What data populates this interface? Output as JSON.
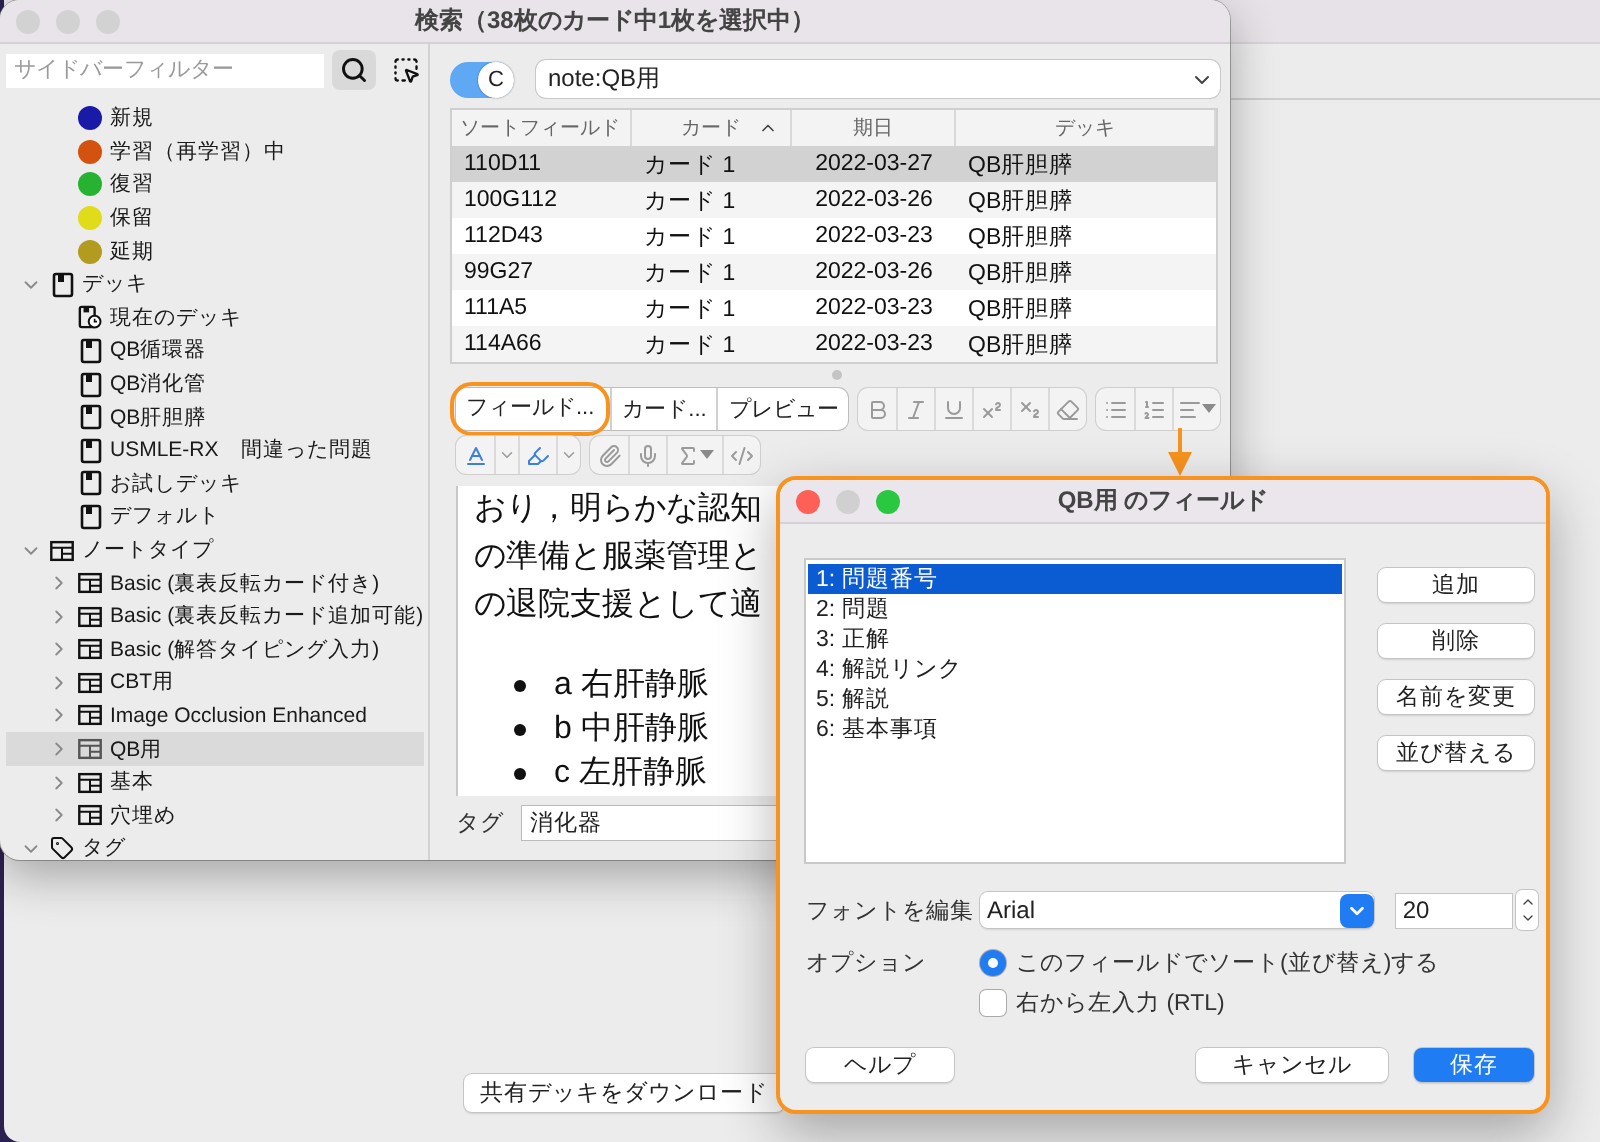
{
  "browser_window": {
    "title": "検索（38枚のカード中1枚を選択中）",
    "sidebar": {
      "filter": {
        "placeholder": "サイドバーフィルター"
      },
      "card_states": [
        {
          "label": "新規",
          "color": "#1a1aa8"
        },
        {
          "label": "学習（再学習）中",
          "color": "#d4520f"
        },
        {
          "label": "復習",
          "color": "#28b232"
        },
        {
          "label": "保留",
          "color": "#e0dc1a"
        },
        {
          "label": "延期",
          "color": "#b39b1f"
        }
      ],
      "sections": [
        {
          "label": "デッキ",
          "kind": "deck",
          "expanded": true,
          "children": [
            {
              "label": "現在のデッキ",
              "kind": "current_deck",
              "selected": false
            },
            {
              "label": "QB循環器",
              "kind": "deck",
              "selected": false
            },
            {
              "label": "QB消化管",
              "kind": "deck",
              "selected": false
            },
            {
              "label": "QB肝胆膵",
              "kind": "deck",
              "selected": false
            },
            {
              "label": "USMLE-RX　間違った問題",
              "kind": "deck",
              "selected": false
            },
            {
              "label": "お試しデッキ",
              "kind": "deck",
              "selected": false
            },
            {
              "label": "デフォルト",
              "kind": "deck",
              "selected": false
            }
          ]
        },
        {
          "label": "ノートタイプ",
          "kind": "note_type",
          "expanded": true,
          "children": [
            {
              "label": "Basic (裏表反転カード付き)",
              "kind": "note_type",
              "expanded": false,
              "selected": false
            },
            {
              "label": "Basic (裏表反転カード追加可能)",
              "kind": "note_type",
              "expanded": false,
              "selected": false
            },
            {
              "label": "Basic (解答タイピング入力)",
              "kind": "note_type",
              "expanded": false,
              "selected": false
            },
            {
              "label": "CBT用",
              "kind": "note_type",
              "expanded": false,
              "selected": false
            },
            {
              "label": "Image Occlusion Enhanced",
              "kind": "note_type",
              "expanded": false,
              "selected": false
            },
            {
              "label": "QB用",
              "kind": "note_type",
              "expanded": false,
              "selected": true
            },
            {
              "label": "基本",
              "kind": "note_type",
              "expanded": false,
              "selected": false
            },
            {
              "label": "穴埋め",
              "kind": "note_type",
              "expanded": false,
              "selected": false
            }
          ]
        },
        {
          "label": "タグ",
          "kind": "tag",
          "expanded": true
        }
      ]
    },
    "search": {
      "mode": {
        "label": "C",
        "on": true
      },
      "query": "note:QB用"
    },
    "table": {
      "columns": [
        {
          "label": "ソートフィールド"
        },
        {
          "label": "カード",
          "sorted": true
        },
        {
          "label": "期日"
        },
        {
          "label": "デッキ"
        }
      ],
      "rows": [
        {
          "cells": [
            "110D11",
            "カード 1",
            "2022-03-27",
            "QB肝胆膵"
          ],
          "selected": true
        },
        {
          "cells": [
            "100G112",
            "カード 1",
            "2022-03-26",
            "QB肝胆膵"
          ],
          "selected": false
        },
        {
          "cells": [
            "112D43",
            "カード 1",
            "2022-03-23",
            "QB肝胆膵"
          ],
          "selected": false
        },
        {
          "cells": [
            "99G27",
            "カード 1",
            "2022-03-26",
            "QB肝胆膵"
          ],
          "selected": false
        },
        {
          "cells": [
            "111A5",
            "カード 1",
            "2022-03-23",
            "QB肝胆膵"
          ],
          "selected": false
        },
        {
          "cells": [
            "114A66",
            "カード 1",
            "2022-03-23",
            "QB肝胆膵"
          ],
          "selected": false
        }
      ]
    },
    "editor": {
      "buttons": [
        "フィールド...",
        "カード...",
        "プレビュー"
      ],
      "content": {
        "lines": [
          "おり，明らかな認知",
          "の準備と服薬管理と",
          "の退院支援として適"
        ],
        "bullets": [
          "a 右肝静脈",
          "b 中肝静脈",
          "c 左肝静脈"
        ]
      },
      "tags": {
        "label": "タグ",
        "value": "消化器"
      }
    }
  },
  "main_window": {
    "buttons": [
      "共有デッキをダウンロード"
    ]
  },
  "fields_dialog": {
    "title": "QB用 のフィールド",
    "fields": [
      {
        "label": "1: 問題番号",
        "selected": true
      },
      {
        "label": "2: 問題",
        "selected": false
      },
      {
        "label": "3: 正解",
        "selected": false
      },
      {
        "label": "4: 解説リンク",
        "selected": false
      },
      {
        "label": "5: 解説",
        "selected": false
      },
      {
        "label": "6: 基本事項",
        "selected": false
      }
    ],
    "actions": [
      "追加",
      "削除",
      "名前を変更",
      "並び替える"
    ],
    "font": {
      "label": "フォントを編集",
      "value": "Arial",
      "size": "20"
    },
    "options": {
      "label": "オプション",
      "items": [
        {
          "kind": "radio",
          "label": "このフィールドでソート(並び替え)する",
          "checked": true
        },
        {
          "kind": "checkbox",
          "label": "右から左入力 (RTL)",
          "checked": false
        }
      ]
    },
    "footer": [
      {
        "label": "ヘルプ",
        "default": false
      },
      {
        "label": "キャンセル",
        "default": false
      },
      {
        "label": "保存",
        "default": true
      }
    ]
  }
}
